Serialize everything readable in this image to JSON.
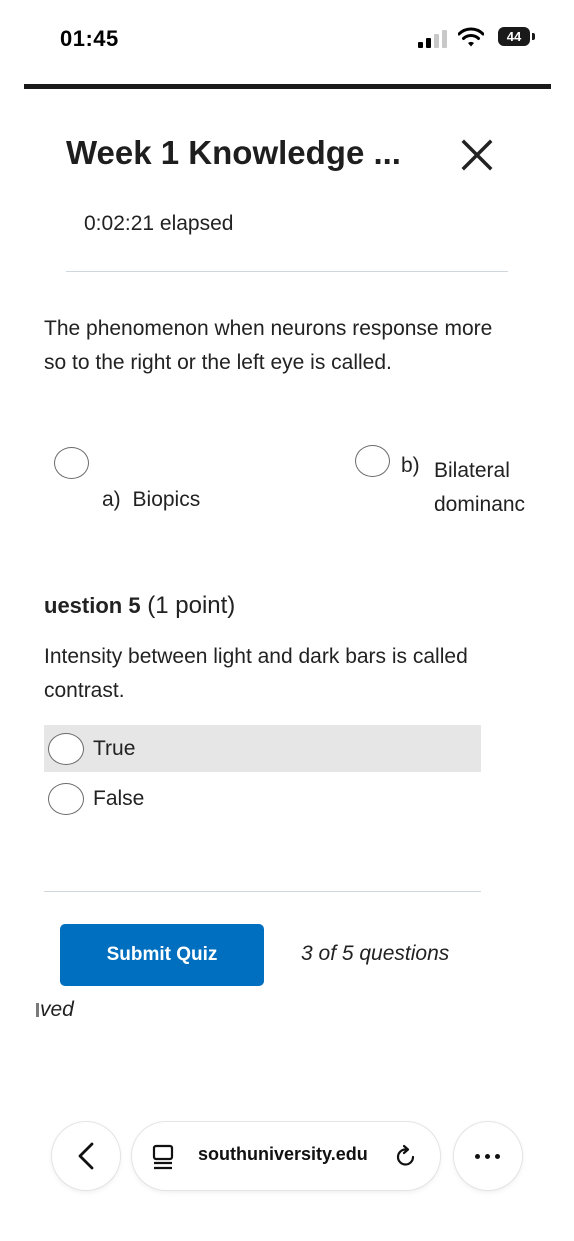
{
  "status_bar": {
    "time": "01:45",
    "battery": "44",
    "icons": [
      "cellular-signal-icon",
      "wifi-icon",
      "battery-icon"
    ]
  },
  "header": {
    "title": "Week 1 Knowledge ...",
    "close_icon": "close-icon",
    "elapsed": "0:02:21 elapsed"
  },
  "question4": {
    "text": "The phenomenon when neurons response more so to the right or the left eye is called.",
    "options": [
      {
        "letter": "a)",
        "label": "Biopics"
      },
      {
        "letter": "b)",
        "label": "Bilateral dominanc"
      }
    ]
  },
  "question5": {
    "heading_num": "uestion 5",
    "heading_points": "(1 point)",
    "text": "Intensity between light and dark bars is called contrast.",
    "options": [
      {
        "label": "True",
        "highlighted": true
      },
      {
        "label": "False",
        "highlighted": false
      }
    ]
  },
  "footer": {
    "submit_label": "Submit Quiz",
    "progress": "3 of 5 questions",
    "saved_fragment": "ved",
    "submit_color": "#006fbf"
  },
  "browser": {
    "url": "southuniversity.edu",
    "back_icon": "chevron-left-icon",
    "tab_icon": "tab-icon",
    "reload_icon": "reload-icon",
    "more_icon": "more-icon"
  }
}
